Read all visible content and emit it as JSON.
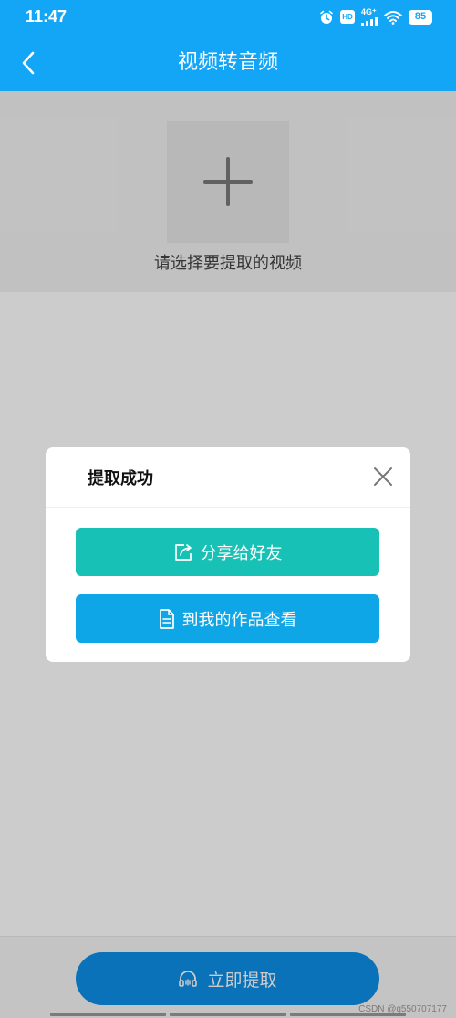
{
  "status_bar": {
    "time": "11:47",
    "network": "4G⁺",
    "hd": "HD",
    "battery": "85",
    "icons": [
      "alarm-icon",
      "hd-icon",
      "signal-icon",
      "wifi-icon",
      "battery-icon"
    ]
  },
  "header": {
    "title": "视频转音频",
    "back_icon": "chevron-left-icon",
    "color": "#13a6f6"
  },
  "upload": {
    "add_icon": "plus-icon",
    "hint": "请选择要提取的视频"
  },
  "dialog": {
    "title": "提取成功",
    "close_icon": "close-icon",
    "share_button": "分享给好友",
    "share_icon": "share-icon",
    "share_color": "#17c1b5",
    "works_button": "到我的作品查看",
    "works_icon": "document-icon",
    "works_color": "#0ea6e6"
  },
  "footer": {
    "extract_button": "立即提取",
    "extract_icon": "headphones-icon",
    "extract_color": "#0d8fe8"
  },
  "watermark": "CSDN @q550707177"
}
